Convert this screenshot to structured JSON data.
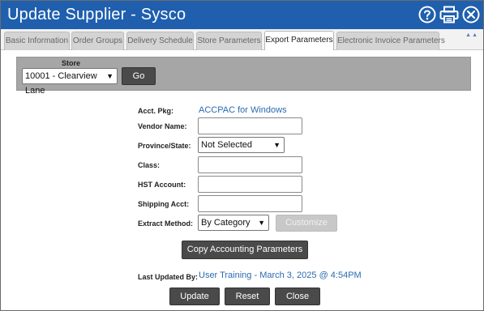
{
  "window": {
    "title": "Update Supplier - Sysco",
    "icons": [
      "help-icon",
      "print-icon",
      "close-icon"
    ]
  },
  "tabs": [
    {
      "label": "Basic Information",
      "active": false
    },
    {
      "label": "Order Groups",
      "active": false
    },
    {
      "label": "Delivery Schedule",
      "active": false
    },
    {
      "label": "Store Parameters",
      "active": false
    },
    {
      "label": "Export Parameters",
      "active": true
    },
    {
      "label": "Electronic Invoice Parameters",
      "active": false
    }
  ],
  "store": {
    "label": "Store",
    "selected": "10001 - Clearview Lane",
    "go_label": "Go"
  },
  "form": {
    "acct_pkg": {
      "label": "Acct. Pkg:",
      "value": "ACCPAC for Windows"
    },
    "vendor_name": {
      "label": "Vendor Name:",
      "value": ""
    },
    "province_state": {
      "label": "Province/State:",
      "selected": "Not Selected"
    },
    "class": {
      "label": "Class:",
      "value": ""
    },
    "hst_account": {
      "label": "HST Account:",
      "value": ""
    },
    "shipping_acct": {
      "label": "Shipping Acct:",
      "value": ""
    },
    "extract_method": {
      "label": "Extract Method:",
      "selected": "By Category"
    },
    "customize_label": "Customize",
    "copy_label": "Copy Accounting Parameters",
    "last_updated": {
      "label": "Last Updated By:",
      "value": "User Training - March 3, 2025 @ 4:54PM"
    }
  },
  "actions": {
    "update": "Update",
    "reset": "Reset",
    "close": "Close"
  },
  "colors": {
    "titlebar": "#1f5fae",
    "link": "#2a6bb0",
    "button_dark": "#4a4a4a",
    "store_bar": "#a6a6a6"
  }
}
